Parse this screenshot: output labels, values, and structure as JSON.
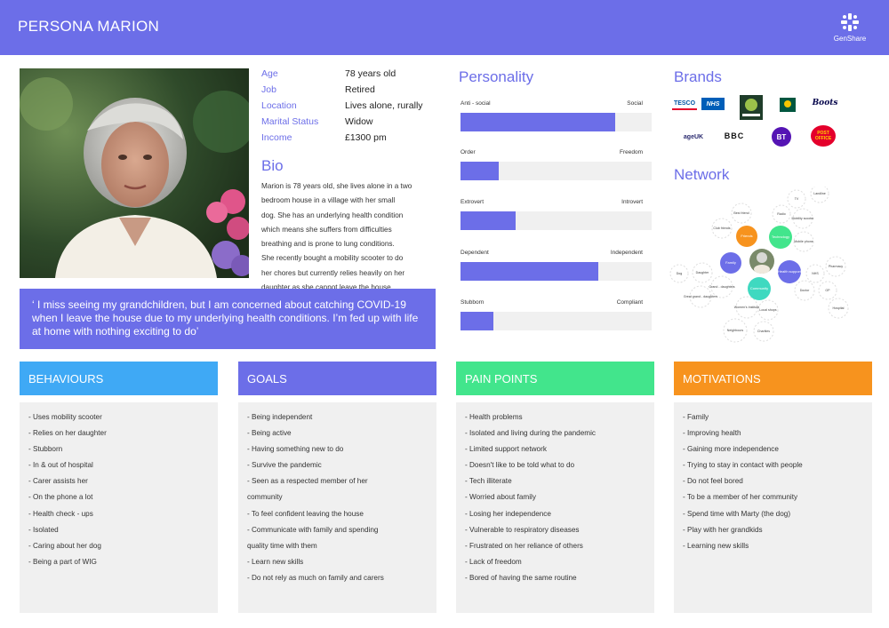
{
  "header": {
    "title": "PERSONA MARION",
    "logo_text": "GenShare"
  },
  "info": [
    {
      "label": "Age",
      "value": "78 years old"
    },
    {
      "label": "Job",
      "value": "Retired"
    },
    {
      "label": "Location",
      "value": "Lives alone, rurally"
    },
    {
      "label": "Marital Status",
      "value": "Widow"
    },
    {
      "label": "Income",
      "value": "£1300 pm"
    }
  ],
  "bio": {
    "title": "Bio",
    "lines": [
      "Marion is 78 years old, she lives alone in a two",
      "bedroom house in a village with her small",
      "dog. She has an underlying health condition",
      "which means she suffers from difficulties",
      "breathing and is prone to lung conditions.",
      "She recently bought a mobility scooter to do",
      "her chores but  currently relies heavily on her",
      "daughter as she cannot leave the house."
    ]
  },
  "quote": "‘ I miss seeing my grandchildren, but I am concerned about catching COVID-19 when I leave the house due to my underlying health conditions. I’m fed up with life at home with nothing exciting to do’",
  "personality": {
    "title": "Personality",
    "sliders": [
      {
        "left": "Anti - social",
        "right": "Social",
        "value": 0.81
      },
      {
        "left": "Order",
        "right": "Freedom",
        "value": 0.2
      },
      {
        "left": "Extrovert",
        "right": "Introvert",
        "value": 0.29
      },
      {
        "left": "Dependent",
        "right": "Independent",
        "value": 0.72
      },
      {
        "left": "Stubborn",
        "right": "Compliant",
        "value": 0.17
      }
    ]
  },
  "brands": {
    "title": "Brands",
    "items": [
      "TESCO",
      "NHS",
      "Women's Institute",
      "Morrisons",
      "Boots",
      "ageUK",
      "BBC",
      "BT",
      "POST OFFICE"
    ]
  },
  "network": {
    "title": "Network",
    "center": "Marion",
    "hubs": [
      "Friends",
      "Technology",
      "Family",
      "Health support",
      "Community"
    ],
    "nodes": [
      "TV",
      "Landline",
      "Radio",
      "Mobility scooter",
      "Mobile phone",
      "Best friend",
      "Club friends",
      "Dog",
      "Daughter",
      "Grand - daughters",
      "Great grand - daughters",
      "NHS",
      "Pharmacy",
      "Doctor",
      "GP",
      "Hospital",
      "Women's Institute",
      "Local shops",
      "Neighbours",
      "Charities"
    ]
  },
  "cards": [
    {
      "title": "BEHAVIOURS",
      "color": "#3FA9F5",
      "items": [
        "- Uses mobility scooter",
        "- Relies on her daughter",
        "- Stubborn",
        "- In & out of hospital",
        "- Carer assists her",
        "- On the phone a lot",
        "- Health check - ups",
        "- Isolated",
        "- Caring about her dog",
        "- Being a part of WIG"
      ]
    },
    {
      "title": "GOALS",
      "color": "#6C6EE8",
      "items": [
        "- Being independent",
        "- Being active",
        "- Having something new to do",
        "- Survive the pandemic",
        "- Seen as a respected member of her",
        "community",
        "- To feel confident leaving the house",
        "- Communicate with family and spending",
        "quality time with them",
        "- Learn new skills",
        "- Do not rely as much on family and carers"
      ]
    },
    {
      "title": "PAIN POINTS",
      "color": "#42E58C",
      "items": [
        "- Health problems",
        "- Isolated and living during the pandemic",
        "- Limited support network",
        "- Doesn't like to be told what to do",
        "- Tech illiterate",
        "- Worried about family",
        "- Losing her independence",
        "- Vulnerable to respiratory diseases",
        "- Frustrated on her reliance of others",
        "- Lack of freedom",
        "- Bored of having the same routine"
      ]
    },
    {
      "title": "MOTIVATIONS",
      "color": "#F7931E",
      "items": [
        "- Family",
        "- Improving health",
        "- Gaining more independence",
        "- Trying to stay in contact with people",
        "- Do not feel bored",
        "- To be a member of her community",
        "- Spend time with Marty (the dog)",
        "- Play with her grandkids",
        "- Learning new skills"
      ]
    }
  ]
}
